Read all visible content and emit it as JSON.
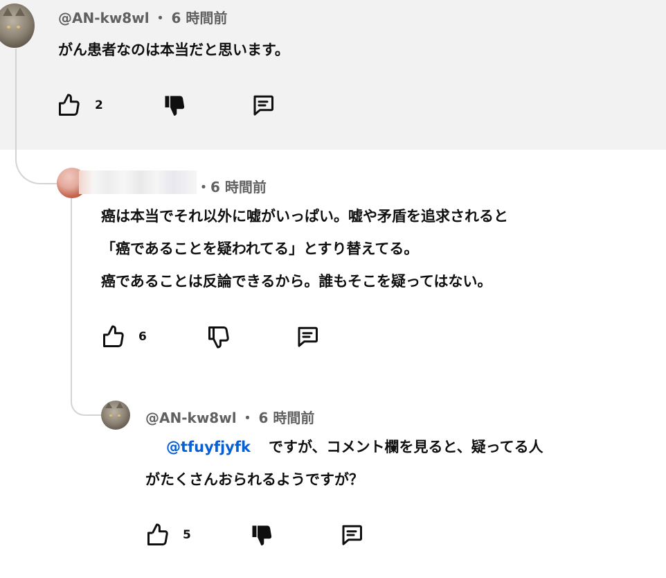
{
  "comments": [
    {
      "author": "@AN-kw8wl",
      "separator": "・",
      "time": "6 時間前",
      "lines": [
        "がん患者なのは本当だと思います。"
      ],
      "likes": "2",
      "dislike_state": "active"
    },
    {
      "author": "",
      "separator": "・",
      "time": "6 時間前",
      "lines": [
        "癌は本当でそれ以外に嘘がいっぱい。嘘や矛盾を追求されると",
        "「癌であることを疑われてる」とすり替えてる。",
        "癌であることは反論できるから。誰もそこを疑ってはない。"
      ],
      "likes": "6",
      "dislike_state": "inactive"
    },
    {
      "author": "@AN-kw8wl",
      "separator": "・",
      "time": "6 時間前",
      "mention": "@tfuyfjyfk",
      "lines": [
        "ですが、コメント欄を見ると、疑ってる人",
        "がたくさんおられるようですが？"
      ],
      "likes": "5",
      "dislike_state": "active"
    }
  ],
  "icons": {
    "like": "thumb-up-icon",
    "dislike": "thumb-down-icon",
    "reply": "reply-icon"
  },
  "colors": {
    "background_highlight": "#f2f2f2",
    "meta_text": "#606060",
    "mention": "#065fd4",
    "thread_line": "#d3d3d3"
  }
}
